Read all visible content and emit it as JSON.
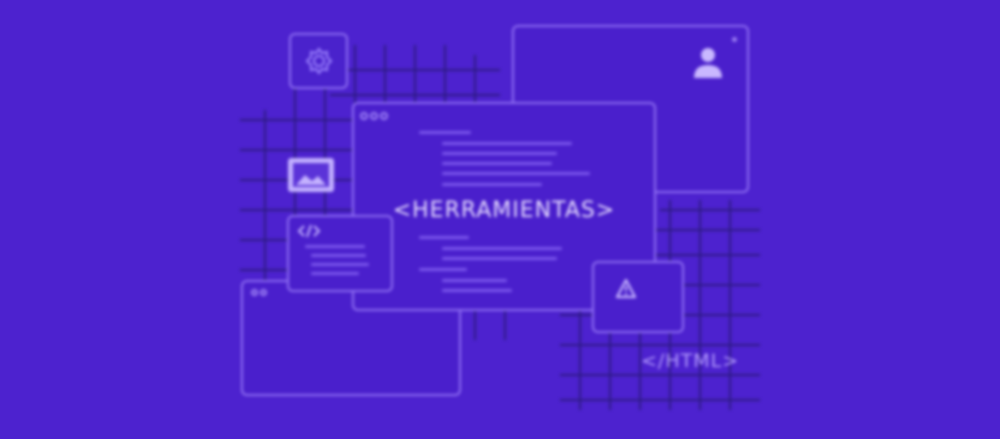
{
  "banner": {
    "title": "<HERRAMIENTAS>",
    "tag": "</HTML>"
  },
  "colors": {
    "background": "#4d22cf",
    "outline": "#a88cff",
    "grid": "#2b1a7a",
    "text": "#e7ddff"
  },
  "icons": [
    "gear-icon",
    "user-icon",
    "image-icon",
    "code-icon",
    "warning-icon"
  ]
}
